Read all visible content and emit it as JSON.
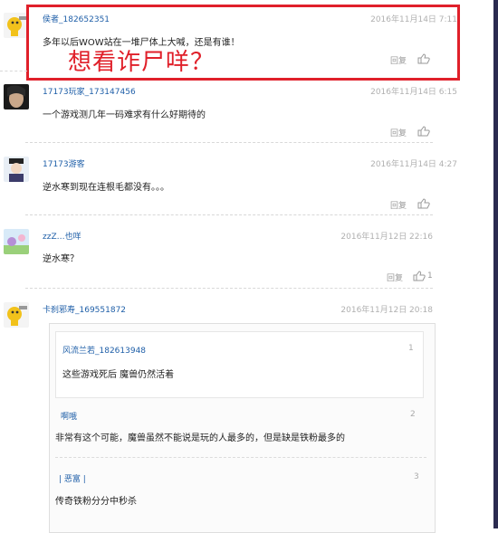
{
  "colors": {
    "accent_red": "#e0202a",
    "username_blue": "#1f5fa8",
    "right_bar": "#2b2b50"
  },
  "annotation": "想看诈尸咩？",
  "comments": [
    {
      "username": "侯者_182652351",
      "time": "2016年11月14日 7:11",
      "text": "多年以后WOW站在一堆尸体上大喊，还是有谁！",
      "reply": "回复",
      "likes": ""
    },
    {
      "username": "17173玩家_173147456",
      "time": "2016年11月14日 6:15",
      "text": "一个游戏测几年一码难求有什么好期待的",
      "reply": "回复",
      "likes": ""
    },
    {
      "username": "17173游客",
      "time": "2016年11月14日 4:27",
      "text": "逆水寒到现在连根毛都没有。。。",
      "reply": "回复",
      "likes": ""
    },
    {
      "username": "zzZ…也咩",
      "time": "2016年11月12日 22:16",
      "text": "逆水寒？",
      "reply": "回复",
      "likes": "1"
    },
    {
      "username": "卡刹邪寿_169551872",
      "time": "2016年11月12日 20:18",
      "text": "",
      "reply": "",
      "likes": ""
    }
  ],
  "quotes": [
    {
      "username": "风流兰若_182613948",
      "num": "1",
      "text": "这些游戏死后 魔兽仍然活着"
    },
    {
      "username": "啊哦",
      "num": "2",
      "text": "非常有这个可能，魔兽虽然不能说是玩的人最多的，但是缺是铁粉最多的"
    },
    {
      "username": "| 恶富 |",
      "num": "3",
      "text": "传奇铁粉分分中秒杀"
    }
  ]
}
